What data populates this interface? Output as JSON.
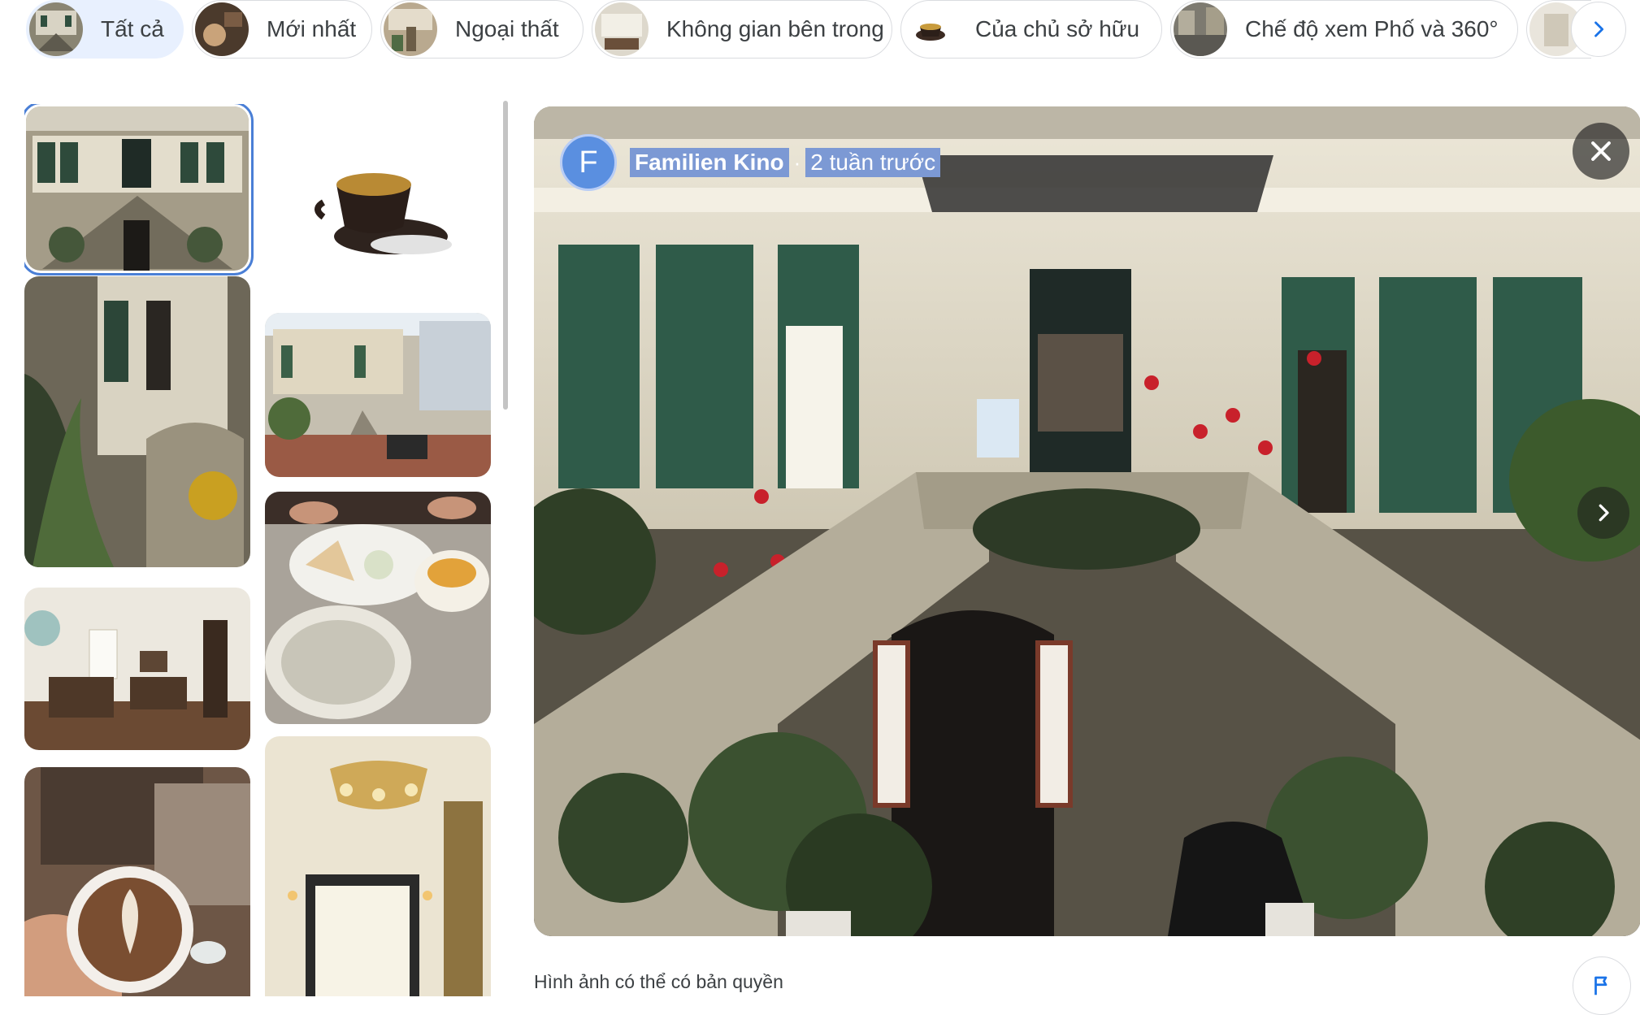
{
  "chips": [
    {
      "label": "Tất cả",
      "active": true
    },
    {
      "label": "Mới nhất",
      "active": false
    },
    {
      "label": "Ngoại thất",
      "active": false
    },
    {
      "label": "Không gian bên trong",
      "active": false
    },
    {
      "label": "Của chủ sở hữu",
      "active": false
    },
    {
      "label": "Chế độ xem Phố và 360°",
      "active": false
    }
  ],
  "viewer": {
    "avatar_letter": "F",
    "author": "Familien Kino",
    "separator": "·",
    "time": "2 tuần trước",
    "close_icon": "close-icon",
    "next_icon": "chevron-right-icon"
  },
  "footer": {
    "copyright": "Hình ảnh có thể có bản quyền",
    "report_icon": "flag-icon"
  },
  "chips_next_icon": "chevron-right-icon",
  "colors": {
    "accent": "#1a73e8",
    "selected_outline": "#4a7fd6",
    "active_chip": "#e8f0fe"
  }
}
